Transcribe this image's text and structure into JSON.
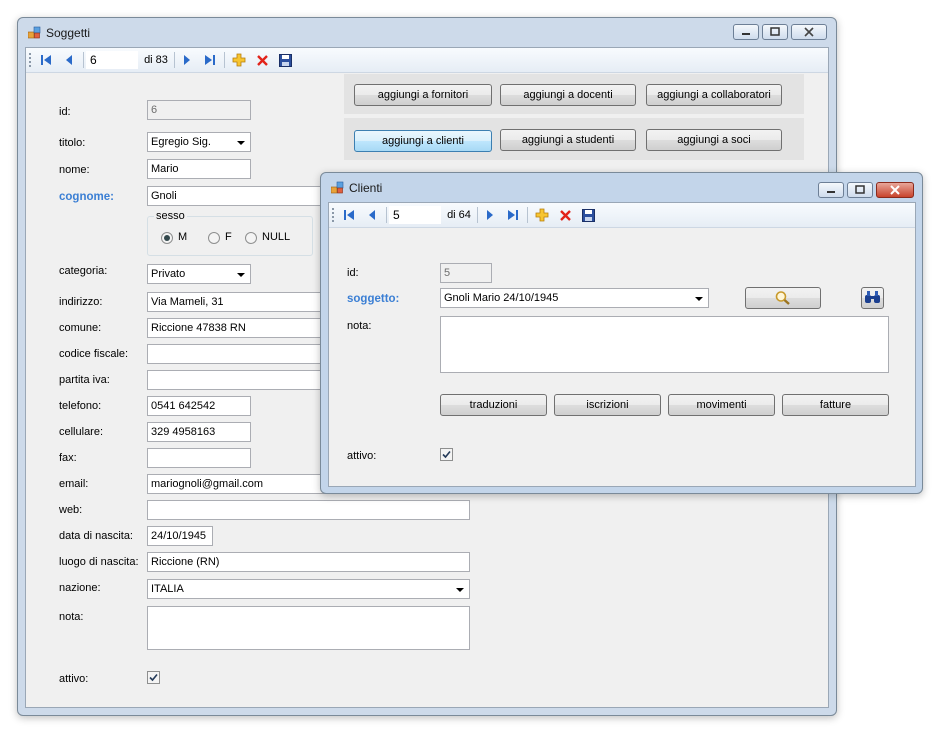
{
  "soggetti": {
    "title": "Soggetti",
    "nav": {
      "position": "6",
      "of_label": "di 83"
    },
    "buttons": {
      "fornitori": "aggiungi a fornitori",
      "docenti": "aggiungi a docenti",
      "collaboratori": "aggiungi a collaboratori",
      "clienti": "aggiungi a clienti",
      "studenti": "aggiungi a studenti",
      "soci": "aggiungi a soci"
    },
    "labels": {
      "id": "id:",
      "titolo": "titolo:",
      "nome": "nome:",
      "cognome": "cognome:",
      "sesso": "sesso",
      "categoria": "categoria:",
      "indirizzo": "indirizzo:",
      "comune": "comune:",
      "codice_fiscale": "codice fiscale:",
      "partita_iva": "partita iva:",
      "telefono": "telefono:",
      "cellulare": "cellulare:",
      "fax": "fax:",
      "email": "email:",
      "web": "web:",
      "data_nascita": "data di nascita:",
      "luogo_nascita": "luogo di nascita:",
      "nazione": "nazione:",
      "nota": "nota:",
      "attivo": "attivo:"
    },
    "values": {
      "id": "6",
      "titolo": "Egregio Sig.",
      "nome": "Mario",
      "cognome": "Gnoli",
      "categoria": "Privato",
      "indirizzo": "Via Mameli, 31",
      "comune": "Riccione 47838 RN",
      "codice_fiscale": "",
      "partita_iva": "",
      "telefono": "0541 642542",
      "cellulare": "329 4958163",
      "fax": "",
      "email": "mariognoli@gmail.com",
      "web": "",
      "data_nascita": "24/10/1945",
      "luogo_nascita": "Riccione (RN)",
      "nazione": "ITALIA",
      "nota": ""
    },
    "sesso_options": {
      "m": "M",
      "f": "F",
      "null": "NULL"
    },
    "sesso_selected": "M",
    "attivo_checked": true
  },
  "clienti": {
    "title": "Clienti",
    "nav": {
      "position": "5",
      "of_label": "di 64"
    },
    "labels": {
      "id": "id:",
      "soggetto": "soggetto:",
      "nota": "nota:",
      "attivo": "attivo:"
    },
    "values": {
      "id": "5",
      "soggetto": "Gnoli Mario 24/10/1945",
      "nota": ""
    },
    "buttons": {
      "traduzioni": "traduzioni",
      "iscrizioni": "iscrizioni",
      "movimenti": "movimenti",
      "fatture": "fatture"
    },
    "attivo_checked": true
  },
  "icons": [
    "app-icon",
    "first-record-icon",
    "prev-record-icon",
    "next-record-icon",
    "last-record-icon",
    "add-icon",
    "delete-icon",
    "save-icon",
    "search-icon",
    "binoculars-icon",
    "minimize-icon",
    "maximize-icon",
    "close-icon"
  ]
}
